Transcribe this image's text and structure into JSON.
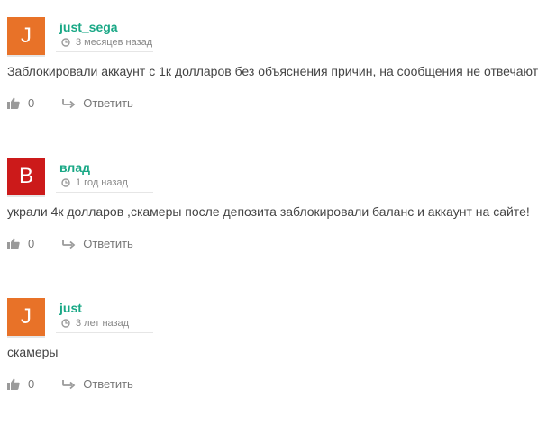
{
  "comments": [
    {
      "avatar_letter": "J",
      "avatar_color": "#e87228",
      "author": "just_sega",
      "time": "3 месяцев назад",
      "text": "Заблокировали аккаунт с 1к долларов без объяснения причин, на сообщения не отвечают",
      "likes": "0",
      "reply_label": "Ответить"
    },
    {
      "avatar_letter": "B",
      "avatar_color": "#cc1a1a",
      "author": "влад",
      "time": "1 год назад",
      "text": "украли 4к долларов ,скамеры после депозита заблокировали баланс и аккаунт на сайте!",
      "likes": "0",
      "reply_label": "Ответить"
    },
    {
      "avatar_letter": "J",
      "avatar_color": "#e87228",
      "author": "just",
      "time": "3 лет назад",
      "text": "скамеры",
      "likes": "0",
      "reply_label": "Ответить"
    }
  ],
  "colors": {
    "author": "#1aa886",
    "icon": "#9a9a9a"
  },
  "icons": [
    "clock-icon",
    "thumbs-up-icon",
    "reply-arrow-icon"
  ]
}
